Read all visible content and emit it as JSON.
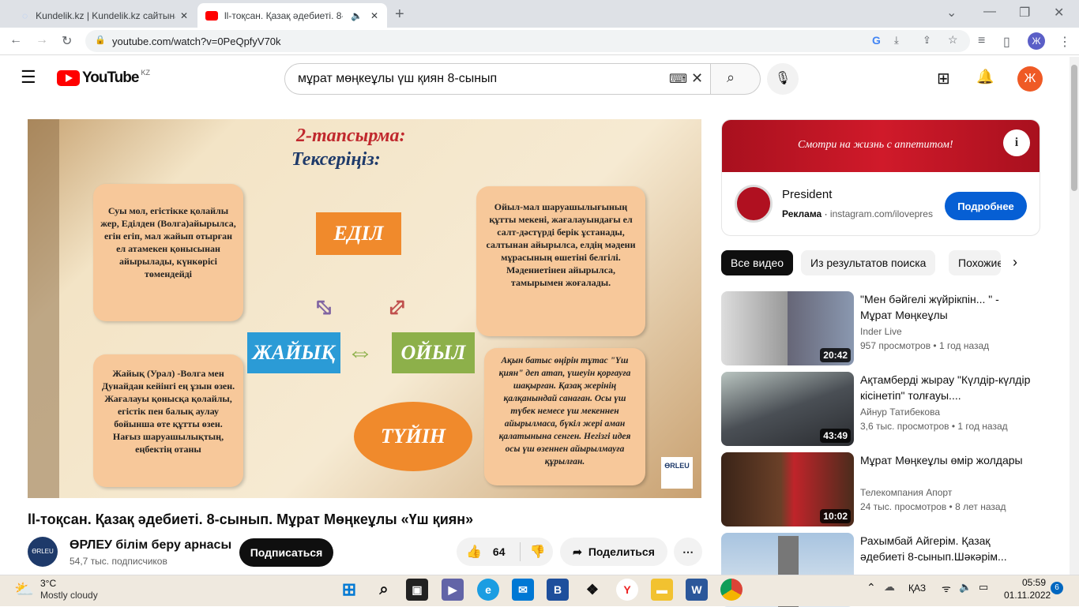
{
  "browser": {
    "tabs": [
      {
        "label": "Kundelik.kz | Kundelik.kz сайтына"
      },
      {
        "label": "ll-тоқсан. Қазақ әдебиеті. 8-"
      }
    ],
    "url": "youtube.com/watch?v=0PeQpfyV70k",
    "profile_initial": "Ж"
  },
  "youtube": {
    "logo_text": "YouTube",
    "region": "KZ",
    "search_value": "мұрат мөңкеұлы үш қиян 8-сынып",
    "avatar_initial": "Ж"
  },
  "slide": {
    "title": "2-тапсырма:",
    "subtitle": "Тексеріңіз:",
    "box_tl": "Суы мол, егістікке қолайлы жер, Еділден (Волга)айырылса, егін егіп, мал жайып отырған ел атамекен қонысынан айырылады, күнкөрісі төмендейді",
    "box_tr": "Ойыл-мал шаруашылығының құтты мекені, жағалауындағы ел салт-дәстүрді берік ұстанады, салтынан айырылса, елдің мәдени мұрасының өшетіні белгілі. Мәдениетінен айырылса, тамырымен жоғалады.",
    "box_bl": "Жайық (Урал) -Волга мен Дунайдан кейінгі ең ұзын өзен. Жағалауы қонысқа қолайлы, егістік пен балық аулау бойынша өте құтты өзен. Нағыз шаруашылықтың, еңбектің отаны",
    "box_br": "Ақын батыс өңірін тұтас \"Үш қиян\" деп атап, үшеуін қорғауға шақырған. Қазақ жерінің қалқанындай санаған. Осы үш түбек немесе үш мекеннен айырылмаса, бүкіл жері аман қалатынына сенген. Негізгі идея осы үш өзеннен айырылмауға құрылған.",
    "edil": "ЕДІЛ",
    "zhaiyq": "ЖАЙЫҚ",
    "oiyl": "ОЙЫЛ",
    "tuiin": "ТҮЙІН",
    "watermark": "ӨRLEU"
  },
  "video": {
    "title": "ll-тоқсан. Қазақ әдебиеті. 8-сынып. Мұрат Мөңкеұлы «Үш қиян»",
    "channel": "ӨРЛЕУ білім беру арнасы",
    "subscribers": "54,7 тыс. подписчиков",
    "subscribe_label": "Подписаться",
    "likes": "64",
    "share_label": "Поделиться",
    "more": "⋯"
  },
  "ad": {
    "banner_text": "Смотри на жизнь с аппетитом!",
    "brand": "President",
    "label": "Реклама",
    "link": "instagram.com/ilovepres",
    "cta": "Подробнее"
  },
  "chips": [
    "Все видео",
    "Из результатов поиска",
    "Похожие"
  ],
  "recommendations": [
    {
      "title": "\"Мен бәйгелі жүйрікпін... \" - Мұрат Мөңкеұлы",
      "channel": "Inder Live",
      "views": "957 просмотров",
      "age": "1 год назад",
      "duration": "20:42"
    },
    {
      "title": "Ақтамберді жырау \"Күлдір-күлдір кісінетіп\" толғауы....",
      "channel": "Айнур Татибекова",
      "views": "3,6 тыс. просмотров",
      "age": "1 год назад",
      "duration": "43:49"
    },
    {
      "title": "Мұрат Мөңкеұлы өмір жолдары",
      "channel": "Телекомпания Апорт",
      "views": "24 тыс. просмотров",
      "age": "8 лет назад",
      "duration": "10:02"
    },
    {
      "title": "Рахымбай Айгерім. Қазақ әдебиеті 8-сынып.Шәкәрім...",
      "channel": "",
      "views": "",
      "age": "",
      "duration": ""
    }
  ],
  "taskbar": {
    "weather_temp": "3°C",
    "weather_desc": "Mostly cloudy",
    "lang": "ҚАЗ",
    "time": "05:59",
    "date": "01.11.2022",
    "notifications": "6"
  },
  "colors": {
    "yt_red": "#ff0000",
    "subscribe_bg": "#0f0f0f",
    "cta_blue": "#065fd4",
    "avatar_orange": "#ef5a25"
  }
}
